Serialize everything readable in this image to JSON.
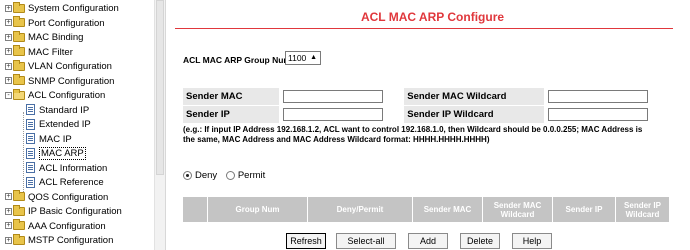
{
  "sidebar": {
    "items": [
      {
        "label": "System Configuration",
        "type": "folder",
        "expander": "+"
      },
      {
        "label": "Port Configuration",
        "type": "folder",
        "expander": "+"
      },
      {
        "label": "MAC Binding",
        "type": "folder",
        "expander": "+"
      },
      {
        "label": "MAC Filter",
        "type": "folder",
        "expander": "+"
      },
      {
        "label": "VLAN Configuration",
        "type": "folder",
        "expander": "+"
      },
      {
        "label": "SNMP Configuration",
        "type": "folder",
        "expander": "+"
      },
      {
        "label": "ACL Configuration",
        "type": "folder-open",
        "expander": "-"
      },
      {
        "label": "Standard IP",
        "type": "page"
      },
      {
        "label": "Extended IP",
        "type": "page"
      },
      {
        "label": "MAC IP",
        "type": "page"
      },
      {
        "label": "MAC ARP",
        "type": "page",
        "selected": true
      },
      {
        "label": "ACL Information",
        "type": "page"
      },
      {
        "label": "ACL Reference",
        "type": "page"
      },
      {
        "label": "QOS Configuration",
        "type": "folder",
        "expander": "+"
      },
      {
        "label": "IP Basic Configuration",
        "type": "folder",
        "expander": "+"
      },
      {
        "label": "AAA Configuration",
        "type": "folder",
        "expander": "+"
      },
      {
        "label": "MSTP Configuration",
        "type": "folder",
        "expander": "+"
      }
    ]
  },
  "main": {
    "title": "ACL MAC ARP Configure",
    "title_color": "#e0373c",
    "group_num": {
      "label": "ACL MAC ARP Group Num:",
      "value": "1100"
    },
    "fields": {
      "sender_mac": {
        "label": "Sender MAC",
        "value": ""
      },
      "sender_mac_wildcard": {
        "label": "Sender MAC Wildcard",
        "value": ""
      },
      "sender_ip": {
        "label": "Sender IP",
        "value": ""
      },
      "sender_ip_wildcard": {
        "label": "Sender IP Wildcard",
        "value": ""
      }
    },
    "hint": "(e.g.: If input IP Address 192.168.1.2, ACL want to control 192.168.1.0, then Wildcard should be 0.0.0.255; MAC Address is the same, MAC Address and MAC Address Wildcard format: HHHH.HHHH.HHHH)",
    "radio": {
      "deny": "Deny",
      "permit": "Permit",
      "selected": "deny"
    },
    "table": {
      "columns": [
        "",
        "Group Num",
        "Deny/Permit",
        "Sender MAC",
        "Sender MAC Wildcard",
        "Sender IP",
        "Sender IP Wildcard"
      ]
    },
    "buttons": {
      "refresh": "Refresh",
      "select_all": "Select-all",
      "add": "Add",
      "delete": "Delete",
      "help": "Help"
    }
  }
}
